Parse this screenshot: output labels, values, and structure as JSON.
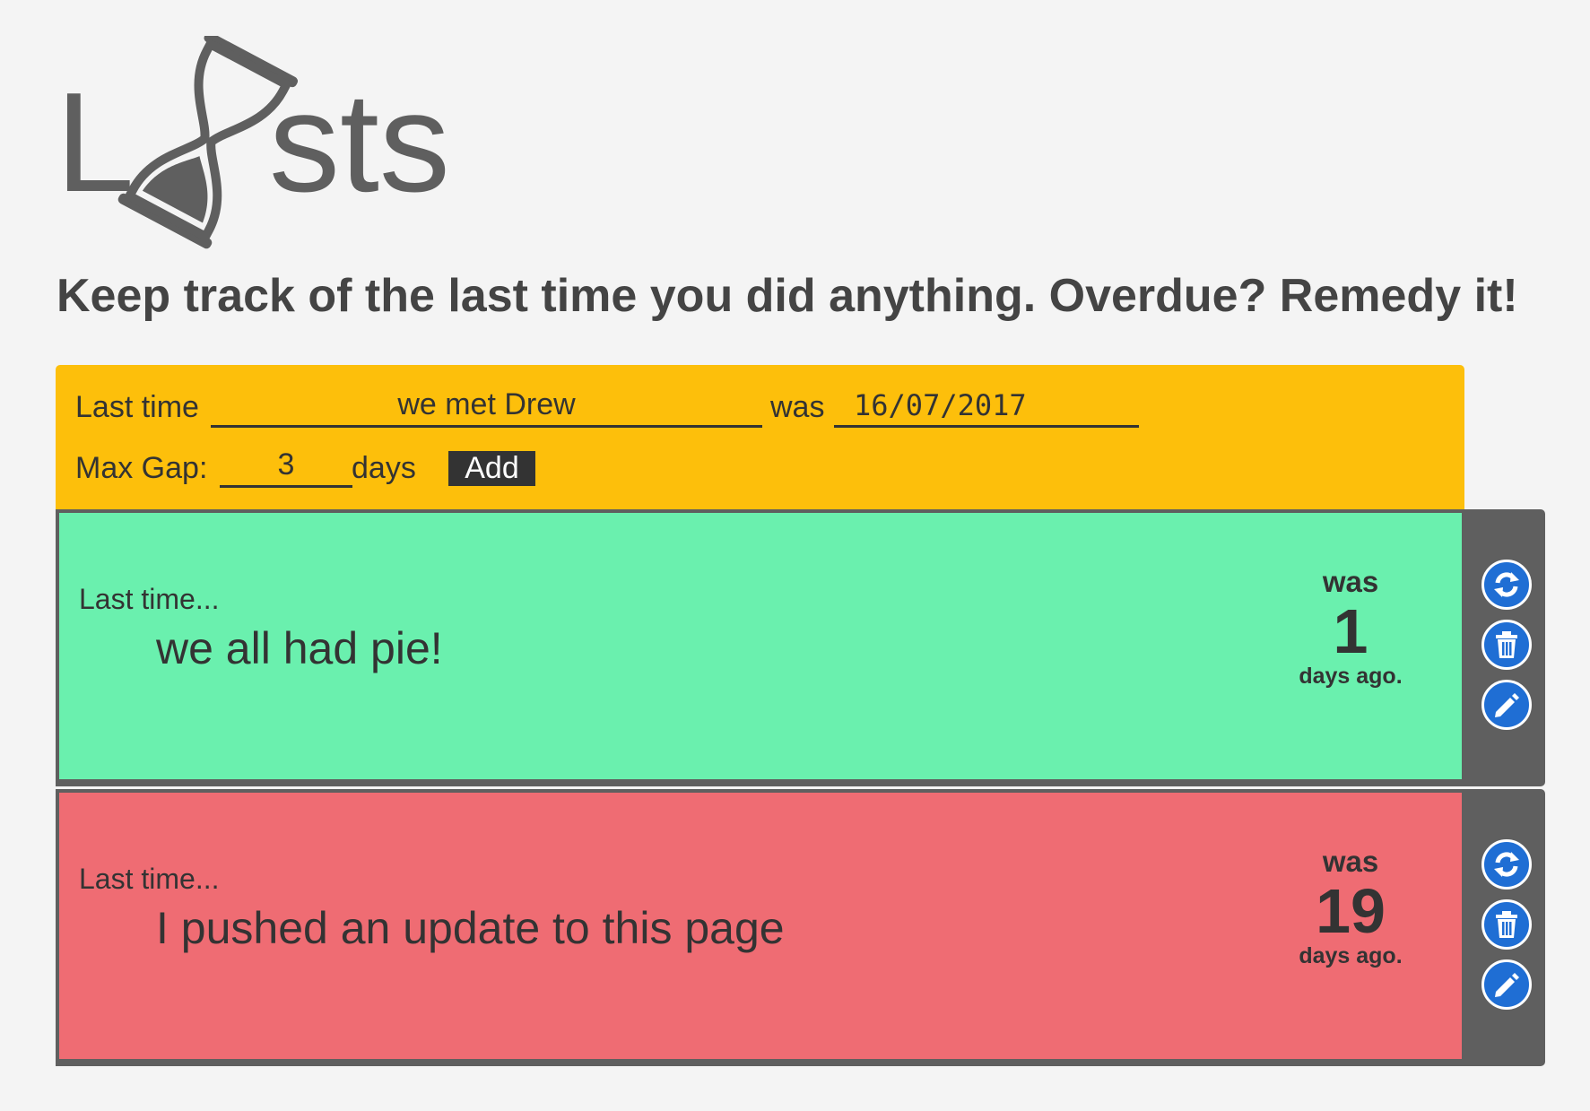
{
  "app": {
    "logo_text_left": "L",
    "logo_text_right": "sts",
    "logo_title": "Lasts",
    "tagline": "Keep track of the last time you did anything. Overdue? Remedy it!"
  },
  "add_form": {
    "label_last_time": "Last time",
    "activity_value": "we met Drew",
    "label_was": "was",
    "date_value": "16/07/2017",
    "label_max_gap": "Max Gap:",
    "max_gap_value": "3",
    "label_days": "days",
    "add_label": "Add"
  },
  "entries": [
    {
      "status": "ok",
      "color": "#6af0ae",
      "prefix": "Last time...",
      "activity": "we all had pie!",
      "was_label": "was",
      "days": "1",
      "days_label": "days ago.",
      "icons": [
        "refresh-icon",
        "trash-icon",
        "pencil-icon"
      ]
    },
    {
      "status": "overdue",
      "color": "#ef6c73",
      "prefix": "Last time...",
      "activity": "I pushed an update to this page",
      "was_label": "was",
      "days": "19",
      "days_label": "days ago.",
      "icons": [
        "refresh-icon",
        "trash-icon",
        "pencil-icon"
      ]
    }
  ],
  "colors": {
    "form_bg": "#fdbf0b",
    "sidebar_bg": "#5f5f5f",
    "icon_button": "#1f6ed4"
  }
}
